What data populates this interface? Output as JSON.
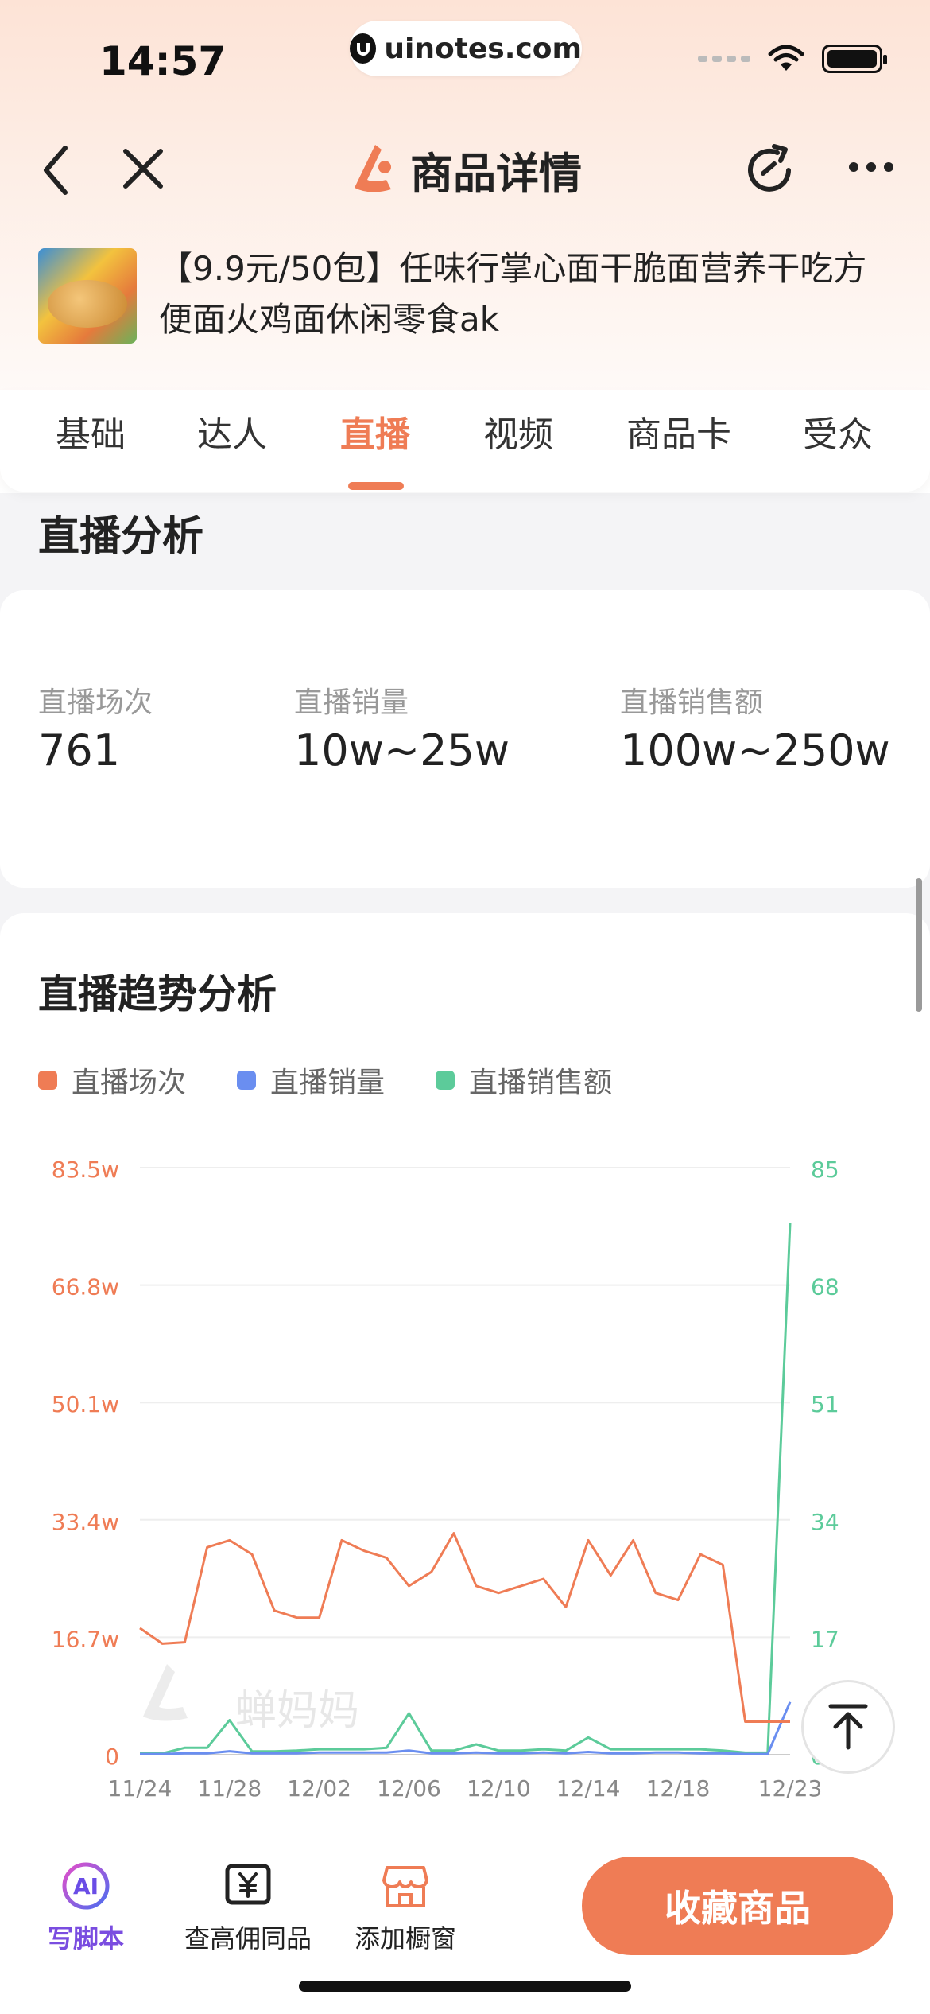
{
  "status": {
    "time": "14:57",
    "url": "uinotes.com"
  },
  "nav": {
    "title": "商品详情"
  },
  "product": {
    "title": "【9.9元/50包】任味行掌心面干脆面营养干吃方便面火鸡面休闲零食ak"
  },
  "tabs": [
    {
      "label": "基础"
    },
    {
      "label": "达人"
    },
    {
      "label": "直播",
      "active": true
    },
    {
      "label": "视频"
    },
    {
      "label": "商品卡"
    },
    {
      "label": "受众"
    }
  ],
  "live_analysis": {
    "section_title": "直播分析",
    "stats": [
      {
        "label": "直播场次",
        "value": "761"
      },
      {
        "label": "直播销量",
        "value": "10w~25w"
      },
      {
        "label": "直播销售额",
        "value": "100w~250w"
      }
    ]
  },
  "trend": {
    "title": "直播趋势分析",
    "watermark": "蝉妈妈"
  },
  "colors": {
    "accent": "#ef7c55",
    "blue": "#6a8ef0",
    "green": "#5ccb9a"
  },
  "chart_data": {
    "type": "line",
    "x": [
      "11/24",
      "11/25",
      "11/26",
      "11/27",
      "11/28",
      "11/29",
      "11/30",
      "12/01",
      "12/02",
      "12/03",
      "12/04",
      "12/05",
      "12/06",
      "12/07",
      "12/08",
      "12/09",
      "12/10",
      "12/11",
      "12/12",
      "12/13",
      "12/14",
      "12/15",
      "12/16",
      "12/17",
      "12/18",
      "12/19",
      "12/20",
      "12/21",
      "12/22",
      "12/23"
    ],
    "x_tick_labels": [
      "11/24",
      "11/28",
      "12/02",
      "12/06",
      "12/10",
      "12/14",
      "12/18",
      "12/23"
    ],
    "y_left_ticks": [
      "0",
      "16.7w",
      "33.4w",
      "50.1w",
      "66.8w",
      "83.5w"
    ],
    "y_left_range": [
      0,
      835000
    ],
    "y_right_ticks": [
      "0",
      "17",
      "34",
      "51",
      "68",
      "85"
    ],
    "y_right_range": [
      0,
      85
    ],
    "series": [
      {
        "name": "直播场次",
        "axis": "left",
        "color": "#ef7c55",
        "values": [
          180000,
          158000,
          160000,
          295000,
          305000,
          285000,
          205000,
          195000,
          195000,
          305000,
          290000,
          280000,
          240000,
          260000,
          315000,
          240000,
          230000,
          240000,
          250000,
          210000,
          305000,
          255000,
          305000,
          230000,
          220000,
          285000,
          270000,
          47000,
          47000,
          47000
        ]
      },
      {
        "name": "直播销量",
        "axis": "left",
        "color": "#6a8ef0",
        "values": [
          1000,
          1000,
          2000,
          2000,
          5000,
          2000,
          2000,
          2000,
          3000,
          3000,
          3000,
          3000,
          6000,
          2000,
          2000,
          3000,
          2000,
          2000,
          3000,
          2000,
          4000,
          2000,
          2000,
          3000,
          3000,
          2000,
          2000,
          1000,
          1000,
          75000
        ]
      },
      {
        "name": "直播销售额",
        "axis": "right",
        "color": "#5ccb9a",
        "values": [
          0.2,
          0.2,
          1,
          1,
          5,
          0.5,
          0.5,
          0.6,
          0.8,
          0.8,
          0.8,
          1,
          6,
          0.6,
          0.6,
          1.5,
          0.6,
          0.6,
          0.8,
          0.6,
          2.5,
          0.8,
          0.8,
          0.8,
          0.8,
          0.8,
          0.6,
          0.3,
          0.3,
          77
        ]
      }
    ],
    "title": "",
    "xlabel": "",
    "ylabel": "",
    "grid": true,
    "legend": "top-left"
  },
  "bottom_bar": {
    "ai": "写脚本",
    "high_commission": "查高佣同品",
    "add_window": "添加橱窗",
    "cta": "收藏商品"
  }
}
